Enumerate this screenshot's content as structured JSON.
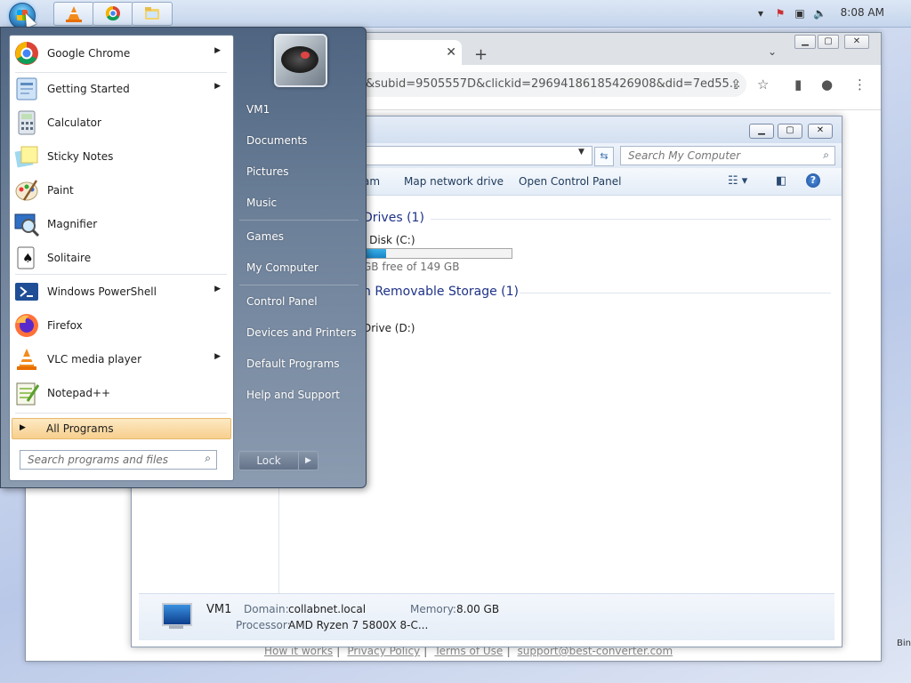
{
  "taskbar": {
    "clock": "8:08 AM",
    "pinned": [
      {
        "name": "vlc-taskbar-button",
        "icon": "vlc-icon"
      },
      {
        "name": "chrome-taskbar-button",
        "icon": "chrome-icon"
      },
      {
        "name": "explorer-taskbar-button",
        "icon": "folder-icon"
      }
    ]
  },
  "browser": {
    "url_fragment": "&subid=9505557D&clickid=29694186185426908&did=7ed55...",
    "footer": {
      "how": "How it works",
      "privacy": "Privacy Policy",
      "terms": "Terms of Use",
      "support": "support@best-converter.com",
      "sep": "|"
    },
    "edge_text": "Bin"
  },
  "explorer": {
    "search_placeholder": "Search My Computer",
    "commands": {
      "cut": "am",
      "map_drive": "Map network drive",
      "control_panel": "Open Control Panel"
    },
    "groups": {
      "drives": "Drives (1)",
      "removable": "h Removable Storage (1)"
    },
    "disk_c": {
      "label": "l Disk (C:)",
      "free_text": "GB free of 149 GB",
      "used_fraction": 0.15
    },
    "drive_d": "Drive (D:)",
    "details": {
      "name": "VM1",
      "domain_label": "Domain:",
      "domain_value": "collabnet.local",
      "memory_label": "Memory:",
      "memory_value": "8.00 GB",
      "processor_label": "Processor:",
      "processor_value": "AMD Ryzen 7 5800X 8-C..."
    }
  },
  "start_menu": {
    "programs": [
      {
        "label": "Google Chrome",
        "icon": "chrome-icon",
        "submenu": true
      },
      {
        "label": "Getting Started",
        "icon": "getting-started-icon",
        "submenu": true
      },
      {
        "label": "Calculator",
        "icon": "calculator-icon",
        "submenu": false
      },
      {
        "label": "Sticky Notes",
        "icon": "sticky-notes-icon",
        "submenu": false
      },
      {
        "label": "Paint",
        "icon": "paint-icon",
        "submenu": false
      },
      {
        "label": "Magnifier",
        "icon": "magnifier-icon",
        "submenu": false
      },
      {
        "label": "Solitaire",
        "icon": "solitaire-icon",
        "submenu": false
      },
      {
        "label": "Windows PowerShell",
        "icon": "powershell-icon",
        "submenu": true
      },
      {
        "label": "Firefox",
        "icon": "firefox-icon",
        "submenu": false
      },
      {
        "label": "VLC media player",
        "icon": "vlc-icon",
        "submenu": true
      },
      {
        "label": "Notepad++",
        "icon": "notepad-plus-plus-icon",
        "submenu": false
      }
    ],
    "all_programs": "All Programs",
    "search_placeholder": "Search programs and files",
    "right_links": {
      "user": "VM1",
      "documents": "Documents",
      "pictures": "Pictures",
      "music": "Music",
      "games": "Games",
      "computer": "My Computer",
      "control_panel": "Control Panel",
      "devices": "Devices and Printers",
      "defaults": "Default Programs",
      "help": "Help and Support"
    },
    "lock": "Lock"
  }
}
